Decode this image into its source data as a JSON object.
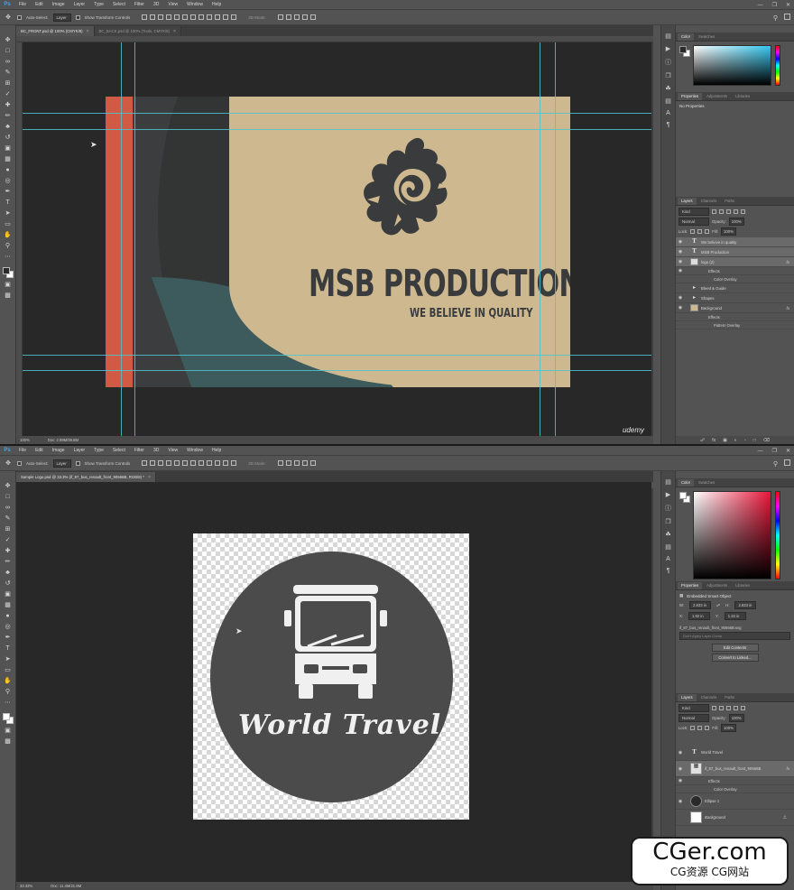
{
  "app": {
    "logo": "Ps",
    "menus": [
      "File",
      "Edit",
      "Image",
      "Layer",
      "Type",
      "Select",
      "Filter",
      "3D",
      "View",
      "Window",
      "Help"
    ]
  },
  "options": {
    "auto_select": "Auto-Select:",
    "target": "Layer",
    "transform_controls": "Show Transform Controls",
    "mode_3d": "3D Mode:"
  },
  "window1": {
    "tabs": [
      {
        "label": "BC_FRONT.psd @ 100% (CMYK/8)",
        "active": true
      },
      {
        "label": "BC_BACK.psd @ 100% (Tools, CMYK/8)",
        "active": false
      }
    ],
    "status": {
      "zoom": "100%",
      "doc": "Doc: 2.99M/39.8M"
    },
    "card": {
      "brand": "MSB PRODUCTION",
      "tagline": "WE BELIEVE IN QUALITY"
    },
    "color_tabs": [
      "Color",
      "Swatches"
    ],
    "props_tabs": [
      "Properties",
      "Adjustments",
      "Libraries"
    ],
    "props_title": "No Properties",
    "layers_tabs": [
      "Layers",
      "Channels",
      "Paths"
    ],
    "layers_controls": {
      "kind": "Kind",
      "blend": "Normal",
      "opacity_label": "Opacity:",
      "opacity": "100%",
      "lock_label": "Lock:",
      "fill_label": "Fill:",
      "fill": "100%"
    },
    "layers": [
      {
        "name": "We believe in quality",
        "kind": "text",
        "selected": true
      },
      {
        "name": "MSB Production",
        "kind": "text",
        "selected": true
      },
      {
        "name": "logo (2)",
        "kind": "smart",
        "selected": true,
        "fx": "fx"
      },
      {
        "name": "Effects",
        "kind": "sub"
      },
      {
        "name": "Color Overlay",
        "kind": "sub2"
      },
      {
        "name": "Bleed & Guide",
        "kind": "folder"
      },
      {
        "name": "Shapes",
        "kind": "folder"
      },
      {
        "name": "Background",
        "kind": "image",
        "fx": "fx"
      },
      {
        "name": "Effects",
        "kind": "sub"
      },
      {
        "name": "Pattern Overlay",
        "kind": "sub2"
      }
    ],
    "watermark": "udemy",
    "colors": {
      "fg": "#2a2a2a",
      "bg": "#ffffff",
      "spectrum_hue": "#35c7ee"
    }
  },
  "window2": {
    "tabs": [
      {
        "label": "Sample Logo.psd @ 33.3% (if_87_bus_renault_front_90566B, RGB/8) *",
        "active": true
      }
    ],
    "status": {
      "zoom": "33.33%",
      "doc": "Doc: 11.4M/21.8M"
    },
    "logo": {
      "title": "World Travel"
    },
    "color_tabs": [
      "Color",
      "Swatches"
    ],
    "props_tabs": [
      "Properties",
      "Adjustments",
      "Libraries"
    ],
    "props": {
      "title": "Embedded Smart Object",
      "w_label": "W:",
      "w": "2.833 in",
      "h_label": "H:",
      "h": "2.833 in",
      "x_label": "X:",
      "x": "1.92 in",
      "y_label": "Y:",
      "y": "1.34 in",
      "file": "if_87_bus_renault_front_90566B.svg",
      "comp_placeholder": "Don't Apply Layer Comp",
      "edit_btn": "Edit Contents",
      "convert_btn": "Convert to Linked..."
    },
    "layers_tabs": [
      "Layers",
      "Channels",
      "Paths"
    ],
    "layers_controls": {
      "kind": "Kind",
      "blend": "Normal",
      "opacity_label": "Opacity:",
      "opacity": "100%",
      "lock_label": "Lock:",
      "fill_label": "Fill:",
      "fill": "100%"
    },
    "layers": [
      {
        "name": "World Travel",
        "kind": "text"
      },
      {
        "name": "if_87_bus_renault_front_90566B",
        "kind": "smart",
        "selected": true,
        "fx": "fx"
      },
      {
        "name": "Effects",
        "kind": "sub"
      },
      {
        "name": "Color Overlay",
        "kind": "sub2"
      },
      {
        "name": "Ellipse 1",
        "kind": "shape"
      },
      {
        "name": "Background",
        "kind": "bg",
        "locked": true
      }
    ],
    "colors": {
      "fg": "#ffffff",
      "bg": "#ffffff",
      "spectrum_hue": "#e8173a"
    }
  },
  "site_watermark": {
    "top": "CGer.com",
    "bottom": "CG资源 CG网站"
  }
}
